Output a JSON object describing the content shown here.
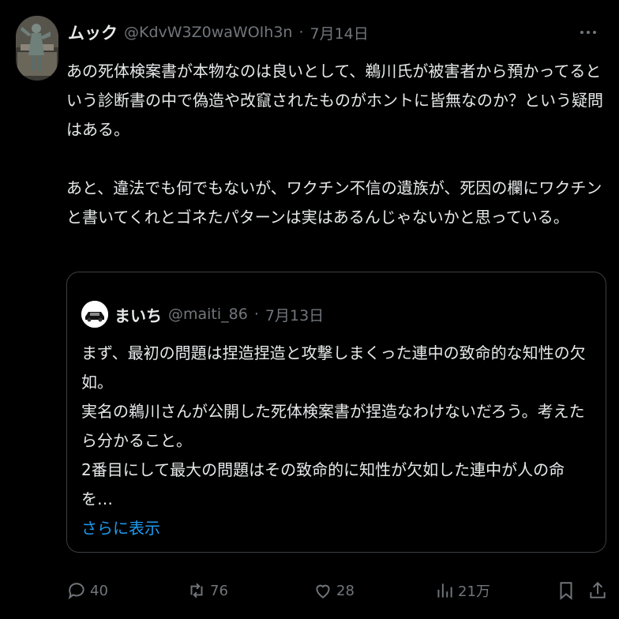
{
  "post": {
    "author_name": "ムック",
    "author_handle": "@KdvW3Z0waWOIh3n",
    "separator": "·",
    "date": "7月14日",
    "text_lines": [
      "あの死体検案書が本物なのは良いとして、鵜川氏が被害者から預かってると",
      "いう診断書の中で偽造や改竄されたものがホントに皆無なのか？という疑問",
      "はある。",
      "あと、違法でも何でもないが、ワクチン不信の遺族が、死因の欄にワクチン",
      "と書いてくれとゴネたパターンは実はあるんじゃないかと思っている。"
    ]
  },
  "quote": {
    "author_name": "まいち",
    "author_handle": "@maiti_86",
    "separator": "·",
    "date": "7月13日",
    "text_lines": [
      "まず、最初の問題は捏造捏造と攻撃しまくった連中の致命的な知性の欠",
      "如。",
      "実名の鵜川さんが公開した死体検案書が捏造なわけないだろう。考えた",
      "ら分かること。",
      "2番目にして最大の問題はその致命的に知性が欠如した連中が人の命を…"
    ],
    "show_more_label": "さらに表示"
  },
  "actions": {
    "replies": "40",
    "reposts": "76",
    "likes": "28",
    "views": "21万"
  },
  "icons": {
    "more": "more-dots-icon",
    "reply": "reply-icon",
    "repost": "repost-icon",
    "like": "heart-icon",
    "views": "views-chart-icon",
    "bookmark": "bookmark-icon",
    "share": "share-icon"
  },
  "colors": {
    "background": "#000000",
    "text": "#e7e9ea",
    "muted": "#71767b",
    "link": "#1d9bf0",
    "border": "#3b3f44"
  }
}
